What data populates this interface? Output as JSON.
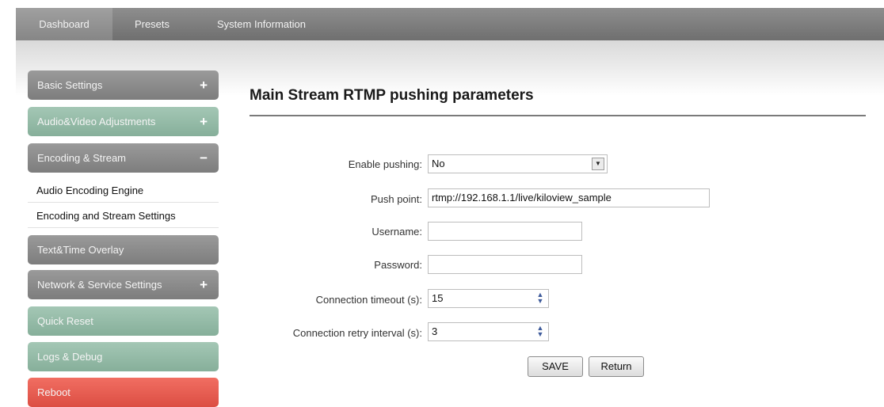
{
  "topnav": {
    "tabs": [
      {
        "label": "Dashboard"
      },
      {
        "label": "Presets"
      },
      {
        "label": "System Information"
      }
    ]
  },
  "sidebar": {
    "items": [
      {
        "label": "Basic Settings",
        "symbol": "+"
      },
      {
        "label": "Audio&Video Adjustments",
        "symbol": "+"
      },
      {
        "label": "Encoding & Stream",
        "symbol": "−"
      },
      {
        "label": "Audio Encoding Engine"
      },
      {
        "label": "Encoding and Stream Settings"
      },
      {
        "label": "Text&Time Overlay"
      },
      {
        "label": "Network & Service Settings",
        "symbol": "+"
      },
      {
        "label": "Quick Reset"
      },
      {
        "label": "Logs & Debug"
      },
      {
        "label": "Reboot"
      }
    ]
  },
  "main": {
    "title": "Main Stream RTMP pushing parameters",
    "fields": {
      "enable_pushing": {
        "label": "Enable pushing:",
        "value": "No"
      },
      "push_point": {
        "label": "Push point:",
        "value": "rtmp://192.168.1.1/live/kiloview_sample"
      },
      "username": {
        "label": "Username:",
        "value": ""
      },
      "password": {
        "label": "Password:",
        "value": ""
      },
      "connection_timeout": {
        "label": "Connection timeout (s):",
        "value": "15"
      },
      "retry_interval": {
        "label": "Connection retry interval (s):",
        "value": "3"
      }
    },
    "buttons": {
      "save": "SAVE",
      "return": "Return"
    }
  },
  "colors": {
    "nav": "#7f7f7f",
    "sidebar_gray": "#8a8a8a",
    "sidebar_green": "#96bba7",
    "reboot_red": "#e85a4f"
  }
}
